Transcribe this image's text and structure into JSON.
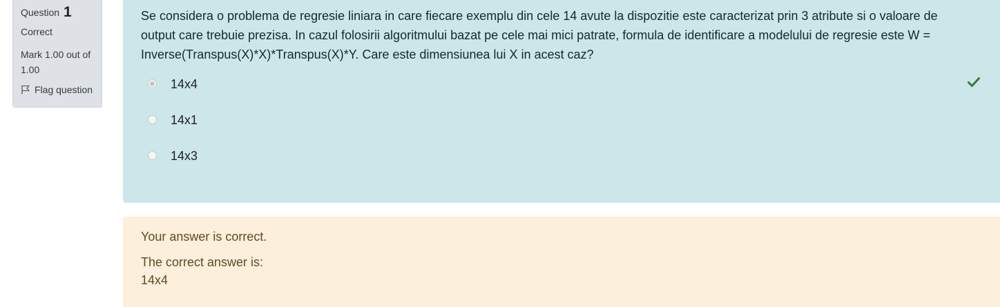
{
  "info": {
    "question_label": "Question",
    "question_number": "1",
    "state": "Correct",
    "grade": "Mark 1.00 out of 1.00",
    "flag_label": "Flag question"
  },
  "question": {
    "text": "Se considera o problema de regresie liniara in care fiecare exemplu din cele 14 avute la dispozitie este caracterizat prin 3 atribute si o valoare de output care trebuie prezisa. In cazul folosirii algoritmului bazat pe cele mai mici patrate, formula de identificare a modelului de regresie este W = Inverse(Transpus(X)*X)*Transpus(X)*Y. Care este dimensiunea lui X in acest caz?",
    "answers": [
      {
        "label": "14x4",
        "selected": true,
        "correct": true
      },
      {
        "label": "14x1",
        "selected": false,
        "correct": false
      },
      {
        "label": "14x3",
        "selected": false,
        "correct": false
      }
    ]
  },
  "feedback": {
    "general": "Your answer is correct.",
    "right_answer_title": "The correct answer is:",
    "right_answer_value": "14x4"
  },
  "colors": {
    "formulation_bg": "#cce6ea",
    "outcome_bg": "#fcefdc",
    "info_bg": "#dee2e6",
    "correct_check": "#357a32"
  },
  "icons": {
    "flag": "flag-icon",
    "correct": "check-icon"
  }
}
